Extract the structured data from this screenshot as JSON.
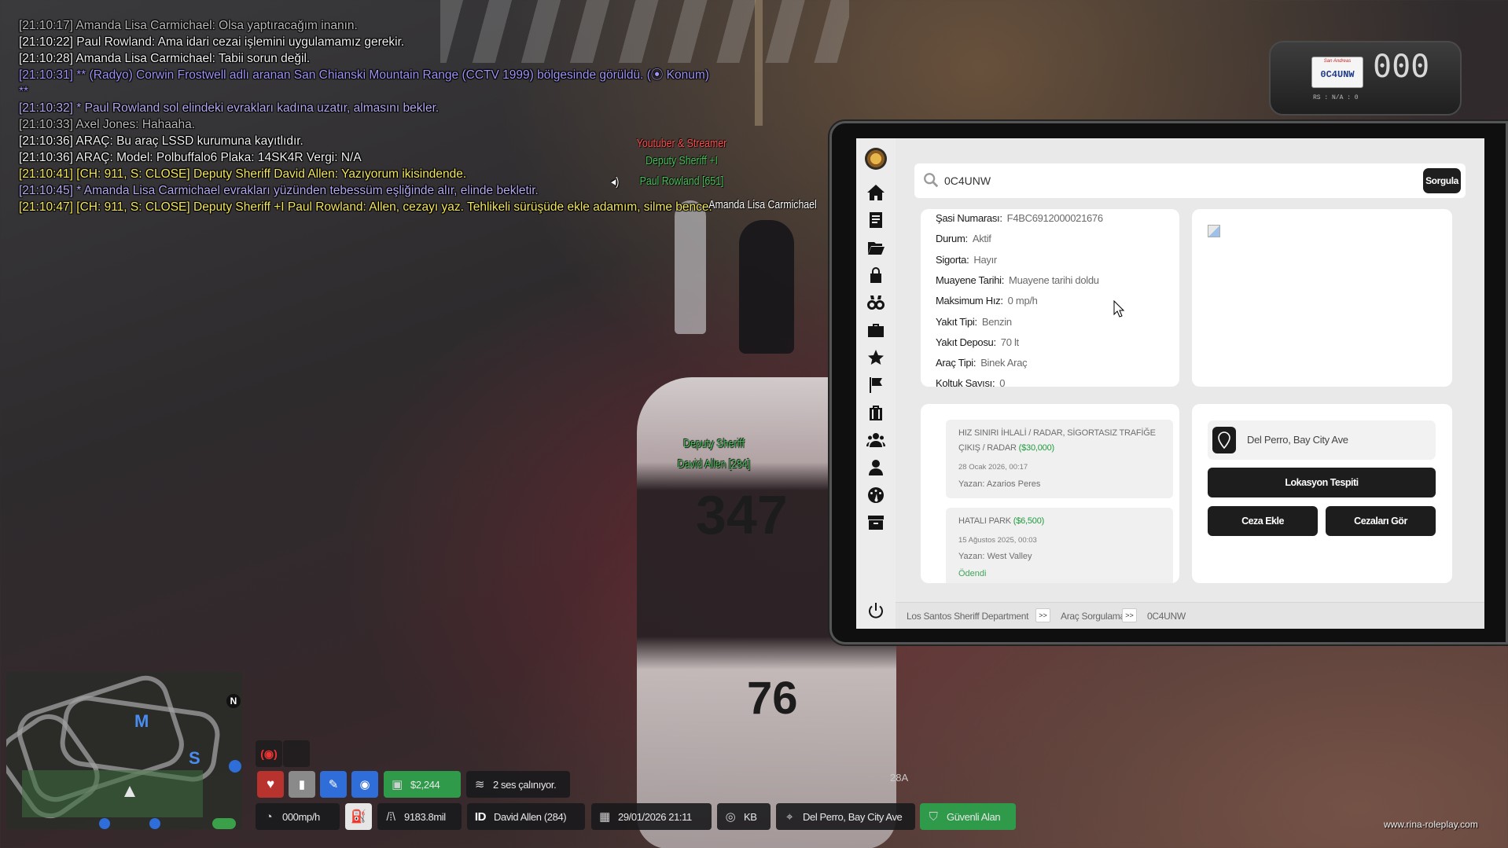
{
  "chat": [
    {
      "time": "[21:10:17]",
      "text": "Amanda Lisa Carmichael: Olsa yaptıracağım inanın.",
      "color": "c-grey"
    },
    {
      "time": "[21:10:22]",
      "text": "Paul Rowland: Ama idari cezai işlemini uygulamamız gerekir.",
      "color": "c-white"
    },
    {
      "time": "[21:10:28]",
      "text": "Amanda Lisa Carmichael: Tabii sorun değil.",
      "color": "c-white"
    },
    {
      "time": "[21:10:31]",
      "text": "** (Radyo) Corwin Frostwell adlı aranan San Chianski Mountain Range (CCTV 1999) bölgesinde görüldü. (⦿ Konum)",
      "color": "c-radio"
    },
    {
      "time": "**",
      "text": "",
      "color": "c-radio"
    },
    {
      "time": "[21:10:32]",
      "text": "* Paul Rowland sol elindeki evrakları kadına uzatır, almasını bekler.",
      "color": "c-purple"
    },
    {
      "time": "[21:10:33]",
      "text": "Axel Jones: Hahaaha.",
      "color": "c-grey"
    },
    {
      "time": "[21:10:36]",
      "text": "ARAÇ: Bu araç LSSD kurumuna kayıtlıdır.",
      "color": "c-white"
    },
    {
      "time": "[21:10:36]",
      "text": "ARAÇ: Model: Polbuffalo6 Plaka: 14SK4R Vergi: N/A",
      "color": "c-white"
    },
    {
      "time": "[21:10:41]",
      "text": "[CH: 911, S: CLOSE] Deputy Sheriff David Allen: Yazıyorum ikisindende.",
      "color": "c-yellow"
    },
    {
      "time": "[21:10:45]",
      "text": "* Amanda Lisa Carmichael evrakları yüzünden tebessüm eşliğinde alır, elinde bekletir.",
      "color": "c-purple"
    },
    {
      "time": "[21:10:47]",
      "text": "[CH: 911, S: CLOSE] Deputy Sheriff +I Paul Rowland: Allen, cezayı yaz. Tehlikeli sürüşüde ekle adamım, silme bence.",
      "color": "c-yellow"
    }
  ],
  "nametags": {
    "rowland_role": "Youtuber & Streamer",
    "rowland_rank": "Deputy Sheriff +I",
    "rowland_name": "Paul Rowland [651]",
    "carmichael": "Amanda Lisa Carmichael",
    "allen_rank": "Deputy Sheriff",
    "allen_name": "David Allen [284]"
  },
  "car": {
    "roof_number": "347",
    "trunk_number": "76"
  },
  "dashcam": {
    "plate_state": "San Andreas",
    "plate": "0C4UNW",
    "speed": "000",
    "sub": "RS : N/A : 0"
  },
  "tablet": {
    "search": {
      "value": "0C4UNW",
      "button": "Sorgula"
    },
    "vehicle": [
      {
        "key": "Şasi Numarası:",
        "value": "F4BC6912000021676"
      },
      {
        "key": "Durum:",
        "value": "Aktif"
      },
      {
        "key": "Sigorta:",
        "value": "Hayır"
      },
      {
        "key": "Muayene Tarihi:",
        "value": "Muayene tarihi doldu"
      },
      {
        "key": "Maksimum Hız:",
        "value": "0 mp/h"
      },
      {
        "key": "Yakıt Tipi:",
        "value": "Benzin"
      },
      {
        "key": "Yakıt Deposu:",
        "value": "70 lt"
      },
      {
        "key": "Araç Tipi:",
        "value": "Binek Araç"
      },
      {
        "key": "Koltuk Sayısı:",
        "value": "0"
      }
    ],
    "fines": [
      {
        "title": "HIZ SINIRI İHLALİ / RADAR, SİGORTASIZ TRAFİĞE ÇIKIŞ / RADAR",
        "amount": "($30,000)",
        "date": "28 Ocak 2026, 00:17",
        "author": "Yazan: Azarios Peres",
        "status": ""
      },
      {
        "title": "HATALI PARK",
        "amount": "($6,500)",
        "date": "15 Ağustos 2025, 00:03",
        "author": "Yazan: West Valley",
        "status": "Ödendi"
      }
    ],
    "location": {
      "text": "Del Perro, Bay City Ave",
      "detect_button": "Lokasyon Tespiti",
      "add_fine_button": "Ceza Ekle",
      "view_fines_button": "Cezaları Gör"
    },
    "breadcrumb": {
      "dept": "Los Santos Sheriff Department",
      "sep": ">>",
      "page": "Araç Sorgulama",
      "plate": "0C4UNW"
    }
  },
  "hud": {
    "money": "$2,244",
    "audio": "2 ses çalınıyor.",
    "speed": "000mp/h",
    "distance": "9183.8mil",
    "id_label": "ID",
    "player": "David Allen (284)",
    "datetime": "29/01/2026 21:11",
    "direction": "KB",
    "location": "Del Perro, Bay City Ave",
    "zone": "Güvenli Alan",
    "zone_code": "28A"
  },
  "minimap": {
    "north": "N",
    "m_marker": "M",
    "s_marker": "S"
  },
  "watermark": "www.rina-roleplay.com"
}
